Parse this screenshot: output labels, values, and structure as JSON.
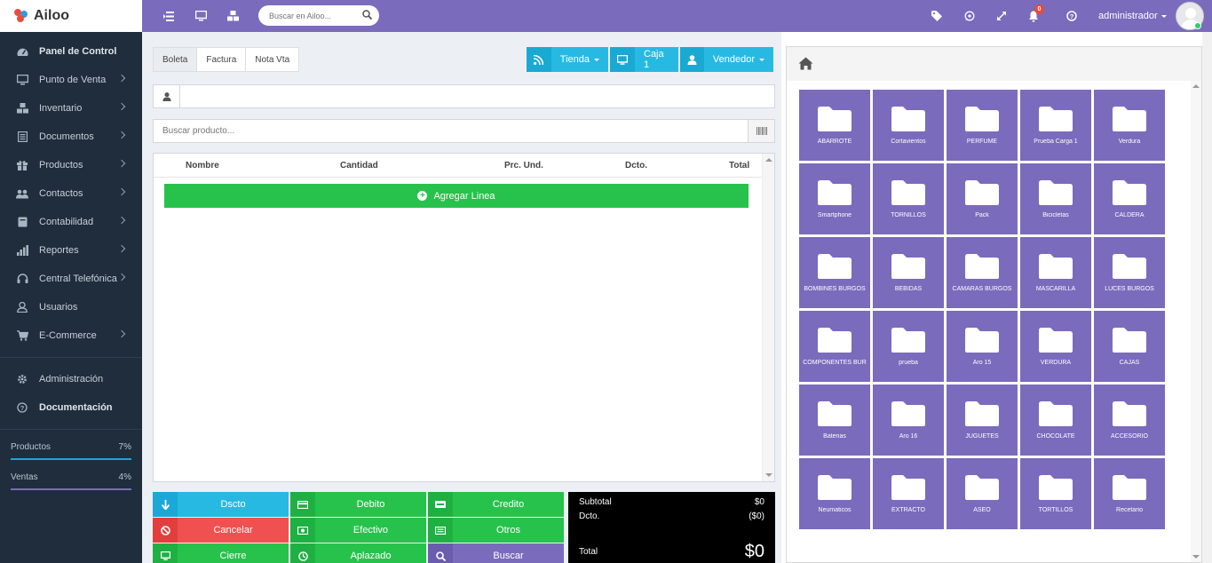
{
  "brand": {
    "name": "Ailoo"
  },
  "sidebar": {
    "items": [
      {
        "label": "Panel de Control",
        "icon": "dashboard-icon",
        "bold": true,
        "chevron": false
      },
      {
        "label": "Punto de Venta",
        "icon": "monitor-icon",
        "bold": false,
        "chevron": true
      },
      {
        "label": "Inventario",
        "icon": "boxes-icon",
        "bold": false,
        "chevron": true
      },
      {
        "label": "Documentos",
        "icon": "document-icon",
        "bold": false,
        "chevron": true
      },
      {
        "label": "Productos",
        "icon": "gift-icon",
        "bold": false,
        "chevron": true
      },
      {
        "label": "Contactos",
        "icon": "users-icon",
        "bold": false,
        "chevron": true
      },
      {
        "label": "Contabilidad",
        "icon": "book-icon",
        "bold": false,
        "chevron": true
      },
      {
        "label": "Reportes",
        "icon": "bar-chart-icon",
        "bold": false,
        "chevron": true
      },
      {
        "label": "Central Telefónica",
        "icon": "headset-icon",
        "bold": false,
        "chevron": true
      },
      {
        "label": "Usuarios",
        "icon": "user-icon",
        "bold": false,
        "chevron": false
      },
      {
        "label": "E-Commerce",
        "icon": "cart-icon",
        "bold": false,
        "chevron": true
      }
    ],
    "bottom_items": [
      {
        "label": "Administración",
        "icon": "gear-icon",
        "bold": false
      },
      {
        "label": "Documentación",
        "icon": "question-icon",
        "bold": true
      }
    ],
    "progress": [
      {
        "label": "Productos",
        "value": "7%",
        "color": "#19a9d3"
      },
      {
        "label": "Ventas",
        "value": "4%",
        "color": "#7a6bbd"
      }
    ]
  },
  "topbar": {
    "search_placeholder": "Buscar en Ailoo...",
    "notifications_count": "0",
    "user_name": "administrador",
    "colors": {
      "bar": "#7a6bbd"
    }
  },
  "pos": {
    "tabs": [
      "Boleta",
      "Factura",
      "Nota Vta"
    ],
    "active_tab": "Boleta",
    "store_label": "Tienda",
    "register_label": "Caja 1",
    "seller_label": "Vendedor",
    "client_value": "",
    "product_search_placeholder": "Buscar producto...",
    "columns": [
      "Nombre",
      "Cantidad",
      "Prc. Und.",
      "Dcto.",
      "Total"
    ],
    "add_line_label": "Agregar Linea",
    "buttons": {
      "discount": "Dscto",
      "cancel": "Cancelar",
      "close": "Cierre",
      "debit": "Debito",
      "cash": "Efectivo",
      "deferred": "Aplazado",
      "credit": "Credito",
      "others": "Otros",
      "search": "Buscar"
    },
    "totals": {
      "subtotal_label": "Subtotal",
      "subtotal_value": "$0",
      "discount_label": "Dcto.",
      "discount_value": "($0)",
      "total_label": "Total",
      "total_value": "$0"
    }
  },
  "categories": [
    "ABARROTE",
    "Cortavientos",
    "PERFUME",
    "Prueba Carga 1",
    "Verdura",
    "Smartphone",
    "TORNILLOS",
    "Pack",
    "Bicicletas",
    "CALDERA",
    "BOMBINES BURGOS",
    "BEBIDAS",
    "CAMARAS BURGOS",
    "MASCARILLA",
    "LUCES BURGOS",
    "COMPONENTES BUR",
    "prueba",
    "Aro 15",
    "VERDURA",
    "CAJAS",
    "Baterias",
    "Aro 16",
    "JUGUETES",
    "CHOCOLATE",
    "ACCESORIO",
    "Neumaticos",
    "EXTRACTO",
    "ASEO",
    "TORTILLOS",
    "Recetario"
  ]
}
